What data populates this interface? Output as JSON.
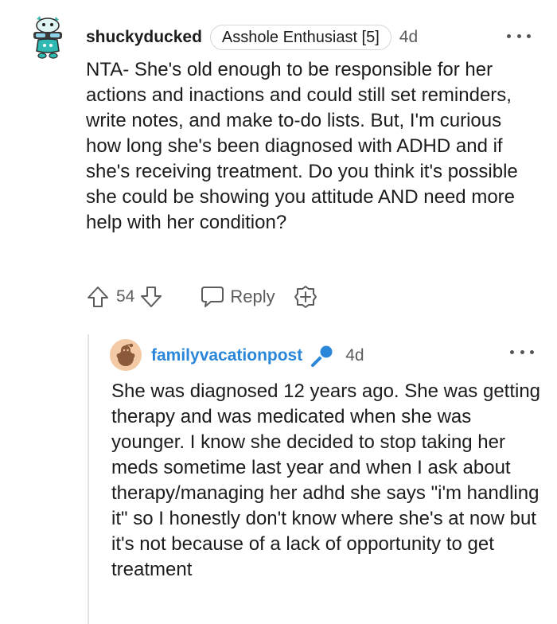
{
  "comment": {
    "avatar_icon": "snoo-avatar-icon",
    "username": "shuckyducked",
    "flair": "Asshole Enthusiast [5]",
    "age": "4d",
    "more_icon": "more-options-icon",
    "body": "NTA- She's old enough to be responsible for her actions and inactions and could still set reminders, write notes, and make to-do lists. But, I'm curious how long she's been diagnosed with ADHD and if she's receiving treatment. Do you think it's possible she could be showing you attitude AND need more help with her condition?",
    "actions": {
      "upvote_icon": "upvote-icon",
      "score": "54",
      "downvote_icon": "downvote-icon",
      "reply_icon": "reply-icon",
      "reply_label": "Reply",
      "award_icon": "award-icon"
    }
  },
  "reply": {
    "avatar_icon": "snoo-avatar-icon",
    "username": "familyvacationpost",
    "op_badge_icon": "microphone-icon",
    "age": "4d",
    "more_icon": "more-options-icon",
    "body": "She was diagnosed 12 years ago. She was getting therapy and was medicated when she was younger. I know she decided to stop taking her meds sometime last year and when I ask about therapy/managing her adhd she says \"i'm handling it\" so I honestly don't know where she's at now but it's not because of a lack of opportunity to get treatment"
  },
  "colors": {
    "op_username": "#2a86d9",
    "mic_badge": "#2a86d9",
    "text": "#1c1c1c",
    "muted": "#5c5c5c",
    "thread_line": "#e3e3e3"
  }
}
